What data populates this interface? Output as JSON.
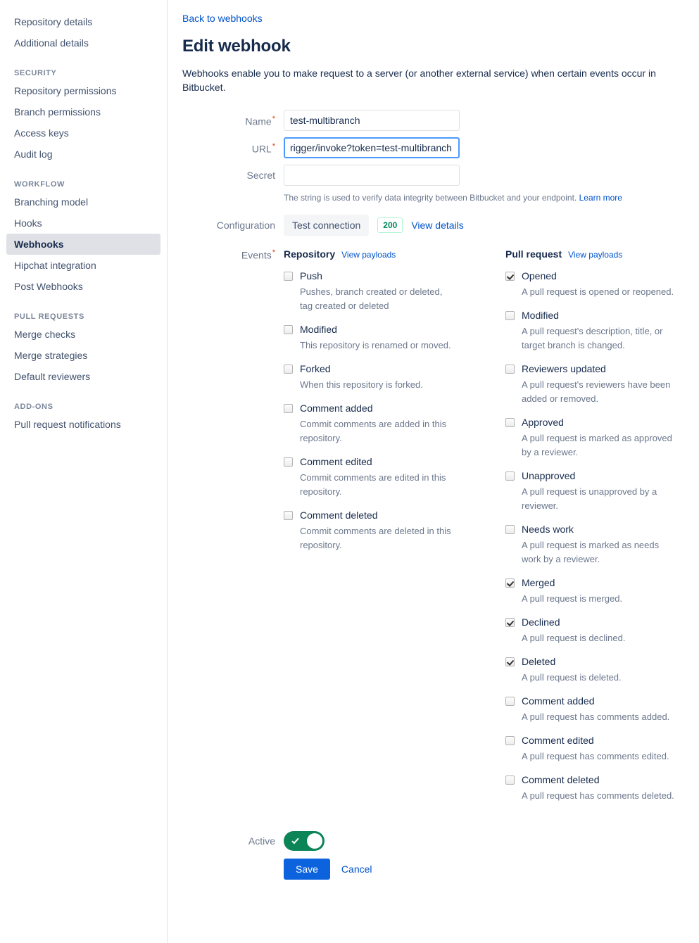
{
  "sidebar": {
    "items": [
      {
        "label": "Repository details",
        "active": false
      },
      {
        "label": "Additional details",
        "active": false
      }
    ],
    "sections": [
      {
        "heading": "SECURITY",
        "items": [
          {
            "label": "Repository permissions",
            "active": false
          },
          {
            "label": "Branch permissions",
            "active": false
          },
          {
            "label": "Access keys",
            "active": false
          },
          {
            "label": "Audit log",
            "active": false
          }
        ]
      },
      {
        "heading": "WORKFLOW",
        "items": [
          {
            "label": "Branching model",
            "active": false
          },
          {
            "label": "Hooks",
            "active": false
          },
          {
            "label": "Webhooks",
            "active": true
          },
          {
            "label": "Hipchat integration",
            "active": false
          },
          {
            "label": "Post Webhooks",
            "active": false
          }
        ]
      },
      {
        "heading": "PULL REQUESTS",
        "items": [
          {
            "label": "Merge checks",
            "active": false
          },
          {
            "label": "Merge strategies",
            "active": false
          },
          {
            "label": "Default reviewers",
            "active": false
          }
        ]
      },
      {
        "heading": "ADD-ONS",
        "items": [
          {
            "label": "Pull request notifications",
            "active": false
          }
        ]
      }
    ]
  },
  "main": {
    "back_link": "Back to webhooks",
    "title": "Edit webhook",
    "description": "Webhooks enable you to make request to a server (or another external service) when certain events occur in Bitbucket.",
    "fields": {
      "name": {
        "label": "Name",
        "required": true,
        "value": "test-multibranch",
        "placeholder": ""
      },
      "url": {
        "label": "URL",
        "required": true,
        "value": "rigger/invoke?token=test-multibranch",
        "placeholder": "",
        "focused": true
      },
      "secret": {
        "label": "Secret",
        "required": false,
        "value": "",
        "placeholder": ""
      }
    },
    "secret_helper": "The string is used to verify data integrity between Bitbucket and your endpoint.",
    "secret_helper_link": "Learn more",
    "configuration": {
      "label": "Configuration",
      "test_button": "Test connection",
      "status_code": "200",
      "view_details": "View details"
    },
    "events": {
      "label": "Events",
      "required": true,
      "columns": [
        {
          "title": "Repository",
          "payloads_link": "View payloads",
          "items": [
            {
              "label": "Push",
              "description": "Pushes, branch created or deleted, tag created or deleted",
              "checked": false
            },
            {
              "label": "Modified",
              "description": "This repository is renamed or moved.",
              "checked": false
            },
            {
              "label": "Forked",
              "description": "When this repository is forked.",
              "checked": false
            },
            {
              "label": "Comment added",
              "description": "Commit comments are added in this repository.",
              "checked": false
            },
            {
              "label": "Comment edited",
              "description": "Commit comments are edited in this repository.",
              "checked": false
            },
            {
              "label": "Comment deleted",
              "description": "Commit comments are deleted in this repository.",
              "checked": false
            }
          ]
        },
        {
          "title": "Pull request",
          "payloads_link": "View payloads",
          "items": [
            {
              "label": "Opened",
              "description": "A pull request is opened or reopened.",
              "checked": true
            },
            {
              "label": "Modified",
              "description": "A pull request's description, title, or target branch is changed.",
              "checked": false
            },
            {
              "label": "Reviewers updated",
              "description": "A pull request's reviewers have been added or removed.",
              "checked": false
            },
            {
              "label": "Approved",
              "description": "A pull request is marked as approved by a reviewer.",
              "checked": false
            },
            {
              "label": "Unapproved",
              "description": "A pull request is unapproved by a reviewer.",
              "checked": false
            },
            {
              "label": "Needs work",
              "description": "A pull request is marked as needs work by a reviewer.",
              "checked": false
            },
            {
              "label": "Merged",
              "description": "A pull request is merged.",
              "checked": true
            },
            {
              "label": "Declined",
              "description": "A pull request is declined.",
              "checked": true
            },
            {
              "label": "Deleted",
              "description": "A pull request is deleted.",
              "checked": true
            },
            {
              "label": "Comment added",
              "description": "A pull request has comments added.",
              "checked": false
            },
            {
              "label": "Comment edited",
              "description": "A pull request has comments edited.",
              "checked": false
            },
            {
              "label": "Comment deleted",
              "description": "A pull request has comments deleted.",
              "checked": false
            }
          ]
        }
      ]
    },
    "footer": {
      "active_label": "Active",
      "active_on": true,
      "save_label": "Save",
      "cancel_label": "Cancel"
    }
  },
  "colors": {
    "link": "#0052cc",
    "save_button": "#0d63de",
    "toggle_on": "#0b8457",
    "status_badge_text": "#00875a",
    "status_badge_border": "#abf5d1",
    "required_star": "#de350b",
    "active_nav_bg": "#dfe1e6"
  }
}
